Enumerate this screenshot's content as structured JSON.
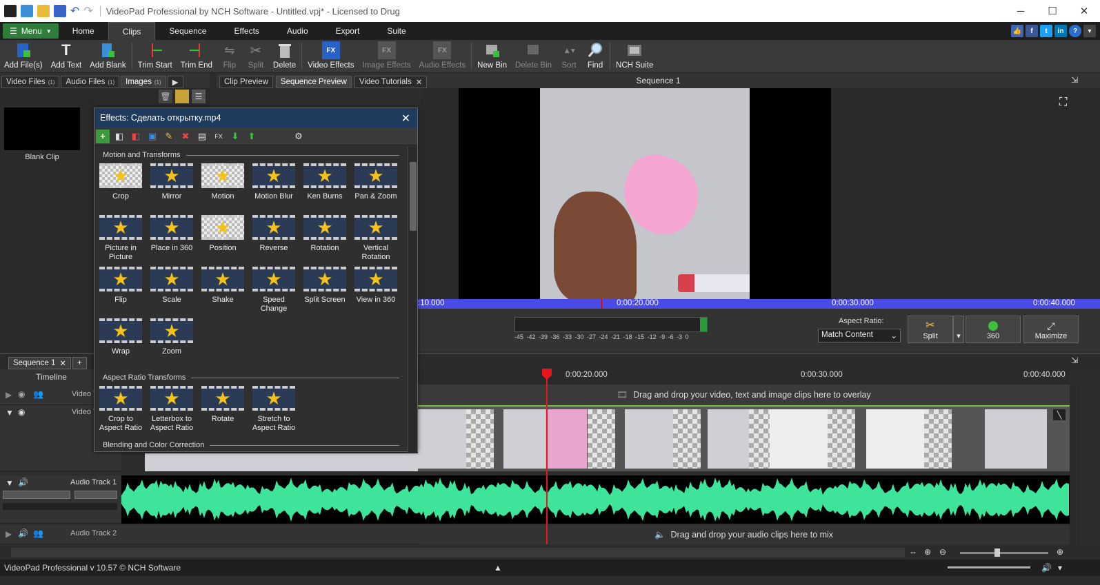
{
  "window": {
    "title": "VideoPad Professional by NCH Software - Untitled.vpj* - Licensed to Drug"
  },
  "menu": {
    "label": "Menu"
  },
  "tabs": [
    "Home",
    "Clips",
    "Sequence",
    "Effects",
    "Audio",
    "Export",
    "Suite"
  ],
  "toolbar": {
    "add_files": "Add File(s)",
    "add_text": "Add Text",
    "add_blank": "Add Blank",
    "trim_start": "Trim Start",
    "trim_end": "Trim End",
    "flip": "Flip",
    "split": "Split",
    "delete": "Delete",
    "video_effects": "Video Effects",
    "image_effects": "Image Effects",
    "audio_effects": "Audio Effects",
    "new_bin": "New Bin",
    "delete_bin": "Delete Bin",
    "sort": "Sort",
    "find": "Find",
    "nch_suite": "NCH Suite"
  },
  "bins": {
    "video": "Video Files",
    "audio": "Audio Files",
    "images": "Images",
    "count": "(1)"
  },
  "clip": {
    "label": "Blank Clip"
  },
  "preview": {
    "tab_clip": "Clip Preview",
    "tab_sequence": "Sequence Preview",
    "tab_tutorials": "Video Tutorials",
    "title": "Sequence 1",
    "ruler": [
      ":10.000",
      "0:00:20.000",
      "0:00:30.000",
      "0:00:40.000"
    ],
    "meter_scale": "-45 -42 -39 -36 -33 -30 -27 -24 -21 -18 -15 -12 -9 -6 -3 0",
    "aspect_label": "Aspect Ratio:",
    "aspect_value": "Match Content",
    "split": "Split",
    "btn_360": "360",
    "maximize": "Maximize"
  },
  "effects": {
    "title": "Effects: Сделать открытку.mp4",
    "section_motion": "Motion and Transforms",
    "motion": [
      "Crop",
      "Mirror",
      "Motion",
      "Motion Blur",
      "Ken Burns",
      "Pan & Zoom",
      "Picture in Picture",
      "Place in 360",
      "Position",
      "Reverse",
      "Rotation",
      "Vertical Rotation",
      "Flip",
      "Scale",
      "Shake",
      "Speed Change",
      "Split Screen",
      "View in 360",
      "Wrap",
      "Zoom"
    ],
    "section_aspect": "Aspect Ratio Transforms",
    "aspect": [
      "Crop to Aspect Ratio",
      "Letterbox to Aspect Ratio",
      "Rotate",
      "Stretch to Aspect Ratio"
    ],
    "section_blend": "Blending and Color Correction"
  },
  "timeline": {
    "seq_tab": "Sequence 1",
    "header": "Timeline",
    "ruler": [
      "0:00:20.000",
      "0:00:30.000",
      "0:00:40.000"
    ],
    "video_track": "Video T",
    "overlay_hint": "Drag and drop your video, text and image clips here to overlay",
    "audio_track1": "Audio Track 1",
    "audio_track2": "Audio Track 2",
    "audio_hint": "Drag and drop your audio clips here to mix"
  },
  "status": {
    "text": "VideoPad Professional v 10.57 © NCH Software"
  },
  "colors": {
    "accent_green": "#2e7d3a",
    "waveform": "#3ee49a",
    "ruler_blue": "#4a4ae6",
    "playhead": "#e8161a"
  }
}
